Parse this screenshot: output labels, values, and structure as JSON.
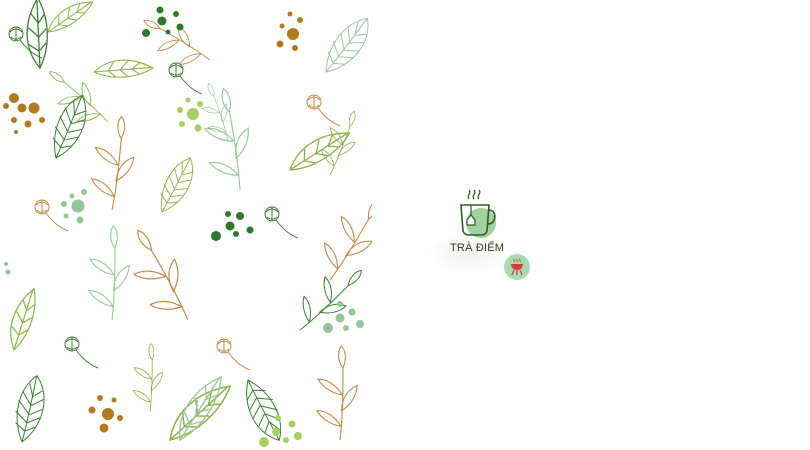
{
  "background": {
    "decoration": "botanical-leaf-pattern",
    "colors": {
      "olive": "#7fa43c",
      "dark_green": "#2f6b2b",
      "mid_green": "#4d8b3a",
      "sage": "#93c49c",
      "light_green": "#b6d66f",
      "brown": "#b07a1e",
      "tan": "#c19660"
    }
  },
  "brand": {
    "name": "TRÀ ĐIẾM",
    "logo_icon": "steaming-teacup-icon",
    "accent_color": "#90c98f"
  },
  "action_badge": {
    "icon": "grill-icon",
    "background": "#a8dcae",
    "icon_color": "#d43c3c"
  }
}
